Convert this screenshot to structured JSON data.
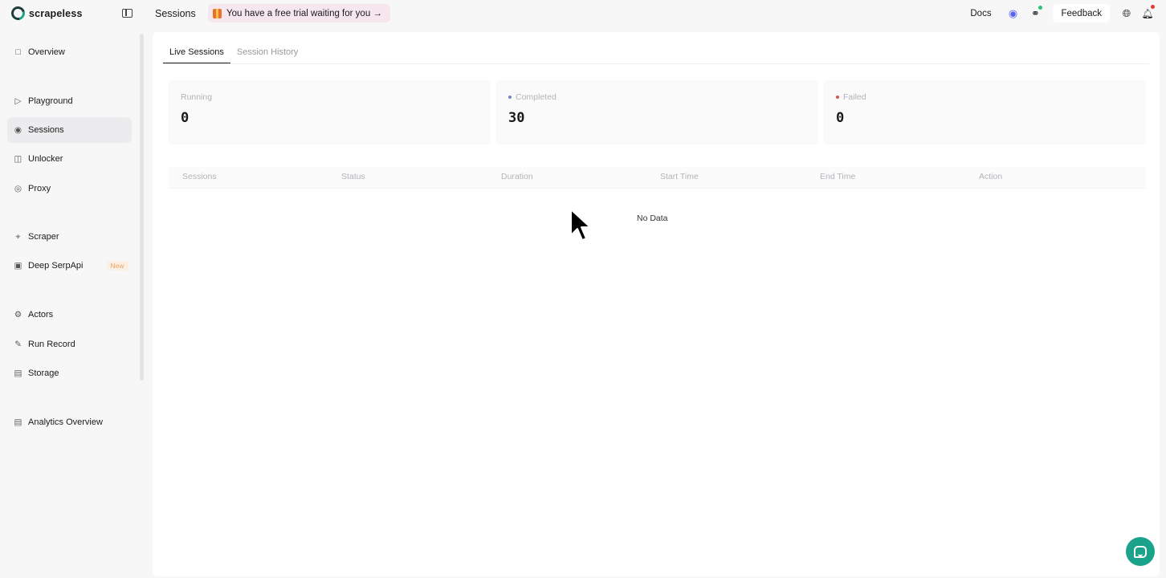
{
  "app": {
    "brand": "scrapeless",
    "page_title": "Sessions",
    "trial_banner": "You have a free trial waiting for you →"
  },
  "header": {
    "docs_label": "Docs",
    "feedback_label": "Feedback"
  },
  "sidebar": {
    "items": [
      {
        "label": "Overview",
        "icon": "monitor-icon"
      },
      {
        "label": "Playground",
        "icon": "playground-icon"
      },
      {
        "label": "Sessions",
        "icon": "sessions-icon",
        "active": true
      },
      {
        "label": "Unlocker",
        "icon": "lock-icon"
      },
      {
        "label": "Proxy",
        "icon": "globe-icon"
      },
      {
        "label": "Scraper",
        "icon": "scraper-icon"
      },
      {
        "label": "Deep SerpApi",
        "icon": "serp-icon",
        "badge": "New"
      },
      {
        "label": "Actors",
        "icon": "gear-icon"
      },
      {
        "label": "Run Record",
        "icon": "record-icon"
      },
      {
        "label": "Storage",
        "icon": "storage-icon"
      },
      {
        "label": "Analytics Overview",
        "icon": "analytics-icon"
      }
    ]
  },
  "main": {
    "tabs": [
      {
        "label": "Live Sessions",
        "active": true
      },
      {
        "label": "Session History",
        "active": false
      }
    ],
    "stats": [
      {
        "label": "Running",
        "value": "0",
        "dot_color": ""
      },
      {
        "label": "Completed",
        "value": "30",
        "dot_color": "#6f86c9"
      },
      {
        "label": "Failed",
        "value": "0",
        "dot_color": "#e05050"
      }
    ],
    "table": {
      "columns": [
        "Sessions",
        "Status",
        "Duration",
        "Start Time",
        "End Time",
        "Action"
      ],
      "empty_text": "No Data"
    }
  },
  "colors": {
    "accent": "#1aa28a",
    "badge_new": "#e9a368"
  }
}
